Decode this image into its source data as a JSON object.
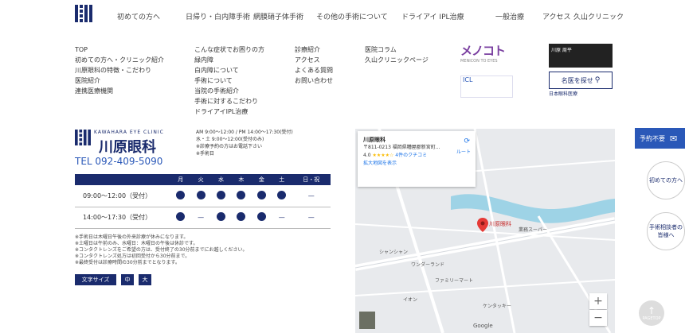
{
  "nav": {
    "items": [
      "初めての方へ",
      "日帰り・白内障手術",
      "網膜硝子体手術",
      "その他の手術について",
      "ドライアイ IPL治療",
      "一般治療",
      "アクセス",
      "久山クリニック"
    ]
  },
  "sitemap": {
    "col1": [
      "TOP",
      "初めての方へ・クリニック紹介",
      "川原眼科の特徴・こだわり",
      "医院紹介",
      "連携医療機関"
    ],
    "col2": [
      "こんな症状でお困りの方",
      "緑内障",
      "白内障について",
      "手術について",
      "当院の手術紹介",
      "手術に対するこだわり",
      "ドライアイIPL治療"
    ],
    "col3": [
      "診療紹介",
      "アクセス",
      "よくある質問",
      "お問い合わせ"
    ],
    "col4": [
      "医院コラム",
      "久山クリニックページ"
    ]
  },
  "banners": {
    "menicon": "メノコト",
    "menicon_sub": "MENICON TO EYES",
    "icl": "ICL",
    "doctor": "川原 周平",
    "search": "名医を探せ",
    "search_sub": "日本眼科医療"
  },
  "clinic": {
    "name_en": "KAWAHARA EYE CLINIC",
    "name_jp": "川原眼科",
    "tel": "TEL 092-409-5090",
    "hours": [
      "AM 9:00～12:00 / PM 14:00～17:30(受付)",
      "水・土 9:00～12:00(受付のみ)",
      "※診療予約の方はお電話下さい",
      "※手術日"
    ]
  },
  "schedule": {
    "headers": [
      "",
      "月",
      "火",
      "水",
      "木",
      "金",
      "土",
      "日・祝"
    ],
    "rows": [
      {
        "time": "09:00～12:00（受付）",
        "marks": [
          "dot",
          "dot",
          "dot",
          "dot",
          "dot",
          "dot",
          "dash"
        ]
      },
      {
        "time": "14:00～17:30（受付）",
        "marks": [
          "dot",
          "dash",
          "dot",
          "dot",
          "dot",
          "dash",
          "dash"
        ]
      }
    ]
  },
  "notes": [
    "※手術日は木曜日午後の外来診療が休みになります。",
    "※土曜日は午前のみ、水曜日：木曜日の午後は休診です。",
    "※コンタクトレンズをご希望の方は、受付終了の30分前までにお越しください。",
    "※コンタクトレンズ処方は初回受付から30分前まで。",
    "※最終受付は診療時間の30分前までとなります。"
  ],
  "font_size": {
    "label": "文字サイズ",
    "small": "中",
    "large": "大"
  },
  "map": {
    "place": "川原眼科",
    "address": "〒811-0213 福岡県糟屋郡新宮町...",
    "rating": "4.0",
    "stars": "★★★★☆",
    "reviews": "4件のクチコミ",
    "directions": "ルート",
    "larger": "拡大地図を表示",
    "pin_label": "川原眼科",
    "labels": [
      "業務スーパー",
      "ワンダーランド",
      "シャンシャン",
      "ファミリーマート",
      "イオン",
      "ケンタッキー"
    ],
    "zoom_in": "+",
    "zoom_out": "−",
    "google": "Google"
  },
  "side": {
    "reserve": "予約不要",
    "first": "初めての方へ",
    "surgery": "手術相談者の皆様へ",
    "pagetop": "PAGETOP"
  }
}
